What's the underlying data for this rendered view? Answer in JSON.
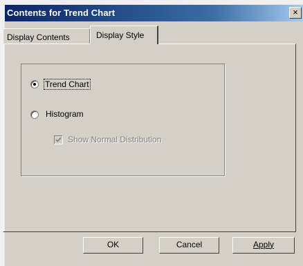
{
  "window": {
    "title": "Contents for Trend Chart",
    "close_glyph": "×"
  },
  "tabs": [
    {
      "label": "Display Contents",
      "selected": false
    },
    {
      "label": "Display Style",
      "selected": true
    }
  ],
  "options": {
    "trend_chart": {
      "label": "Trend Chart",
      "checked": true
    },
    "histogram": {
      "label": "Histogram",
      "checked": false
    },
    "show_normal": {
      "label": "Show Normal Distribution",
      "checked": true,
      "enabled": false
    }
  },
  "buttons": {
    "ok": "OK",
    "cancel": "Cancel",
    "apply": "Apply"
  },
  "colors": {
    "titlebar_start": "#0a246a",
    "titlebar_end": "#a6caf0",
    "face": "#d4d0c8",
    "disabled_text": "#808080"
  }
}
